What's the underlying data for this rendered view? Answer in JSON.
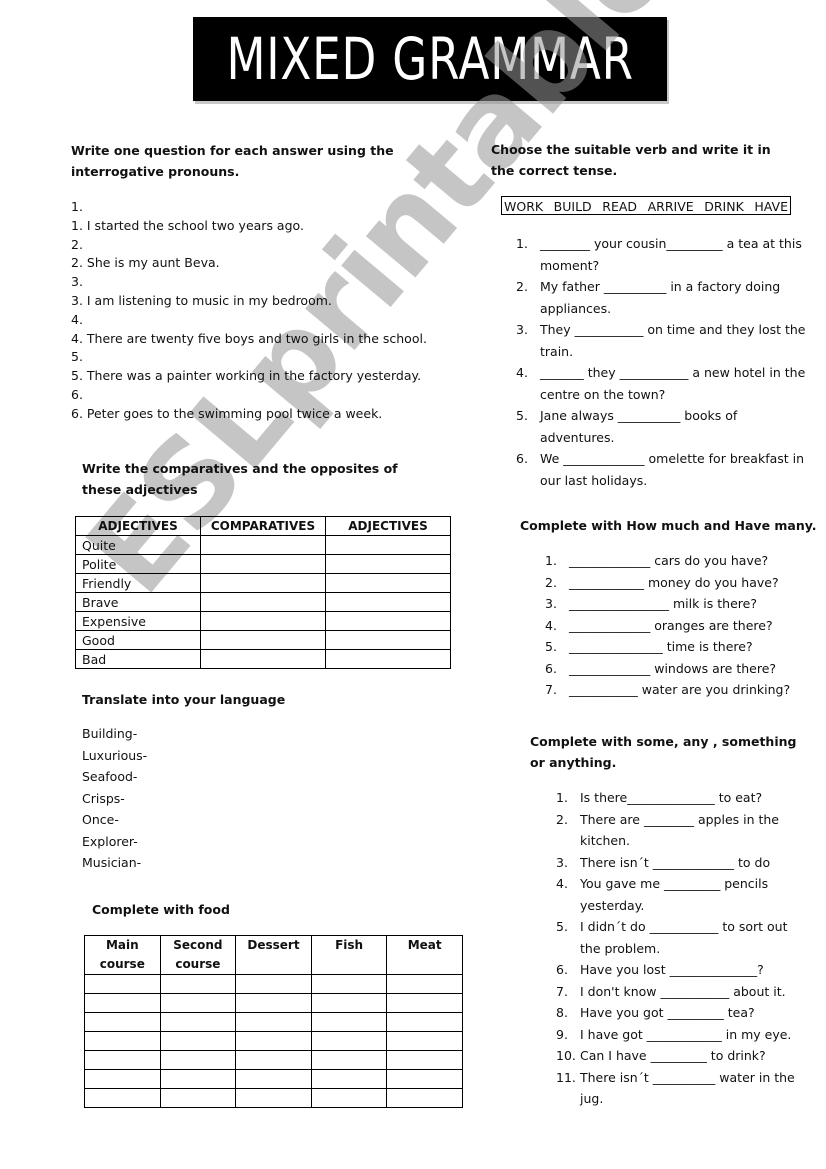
{
  "title": "MIXED GRAMMAR",
  "watermark": "ESLprintables.com",
  "section_questions": {
    "heading": "Write one question for each answer using the interrogative pronouns.",
    "lines": [
      "1.",
      "1. I started the school two years ago.",
      "2.",
      "2. She is my aunt Beva.",
      "3.",
      "3. I am listening to music in my bedroom.",
      "4.",
      "4. There are twenty five boys and two girls in the school.",
      "5.",
      "5. There was a painter working in the factory yesterday.",
      "6.",
      "6. Peter goes to the swimming pool twice a week."
    ]
  },
  "section_comparatives": {
    "heading": "Write the comparatives and the opposites of these adjectives",
    "columns": [
      "ADJECTIVES",
      "COMPARATIVES",
      "ADJECTIVES"
    ],
    "rows": [
      "Quite",
      "Polite",
      "Friendly",
      "Brave",
      "Expensive",
      "Good",
      "Bad"
    ]
  },
  "section_translate": {
    "heading": "Translate into your language",
    "words": [
      "Building-",
      "Luxurious-",
      "Seafood-",
      "Crisps-",
      "Once-",
      "Explorer-",
      "Musician-"
    ]
  },
  "section_food": {
    "heading": "Complete with food",
    "columns": [
      [
        "Main",
        "course"
      ],
      [
        "Second",
        "course"
      ],
      [
        "Dessert",
        ""
      ],
      [
        "Fish",
        ""
      ],
      [
        "Meat",
        ""
      ]
    ],
    "empty_rows": 7
  },
  "section_verbs": {
    "heading": "Choose the suitable  verb and write it in the correct tense.",
    "verbs": [
      "WORK",
      "BUILD",
      "READ",
      "ARRIVE",
      "DRINK",
      "HAVE"
    ],
    "items": [
      {
        "num": "1.",
        "text": "________ your  cousin_________  a tea at this moment?"
      },
      {
        "num": "2.",
        "text": "My father  __________ in a factory doing appliances."
      },
      {
        "num": "3.",
        "text": "They ___________  on time and they lost the train."
      },
      {
        "num": "4.",
        "text": "_______ they ___________ a new hotel in the centre on the town?"
      },
      {
        "num": "5.",
        "text": "Jane always __________  books of adventures."
      },
      {
        "num": "6.",
        "text": "We _____________ omelette for breakfast in  our last holidays."
      }
    ]
  },
  "section_howmuch": {
    "heading": "Complete with  How much and Have many.",
    "items": [
      {
        "num": "1.",
        "text": "_____________ cars do you have?"
      },
      {
        "num": "2.",
        "text": "____________ money do you have?"
      },
      {
        "num": "3.",
        "text": "________________ milk is there?"
      },
      {
        "num": "4.",
        "text": "_____________ oranges are there?"
      },
      {
        "num": "5.",
        "text": "_______________ time is there?"
      },
      {
        "num": "6.",
        "text": "_____________ windows are there?"
      },
      {
        "num": "7.",
        "text": "___________ water are you drinking?"
      }
    ]
  },
  "section_some": {
    "heading": "Complete with some, any , something or anything.",
    "items": [
      {
        "num": "1.",
        "text": "Is there______________ to eat?"
      },
      {
        "num": "2.",
        "text": "There are ________ apples in the kitchen."
      },
      {
        "num": "3.",
        "text": "There isn´t  _____________ to do"
      },
      {
        "num": "4.",
        "text": "You gave me _________ pencils yesterday."
      },
      {
        "num": "5.",
        "text": "I didn´t do ___________ to sort out the problem."
      },
      {
        "num": "6.",
        "text": "Have you lost ______________?"
      },
      {
        "num": "7.",
        "text": "I don't know ___________ about it."
      },
      {
        "num": "8.",
        "text": "Have you got _________ tea?"
      },
      {
        "num": "9.",
        "text": "I have got ____________ in my eye."
      },
      {
        "num": "10.",
        "text": "Can I have _________ to drink?"
      },
      {
        "num": "11.",
        "text": "There isn´t  __________ water in the jug."
      }
    ]
  }
}
